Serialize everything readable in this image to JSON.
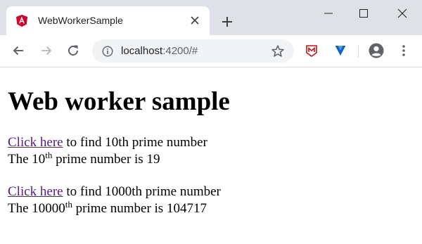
{
  "browser": {
    "tab_title": "WebWorkerSample",
    "url_host": "localhost",
    "url_path": ":4200/#",
    "icons": {
      "favicon": "angular-icon",
      "tab_close": "close-icon",
      "new_tab": "plus-icon",
      "back": "arrow-left-icon",
      "forward": "arrow-right-icon",
      "reload": "reload-icon",
      "site_info": "info-icon",
      "bookmark": "star-icon",
      "extension_1": "mcafee-icon",
      "extension_2": "vpn-icon",
      "profile": "account-icon",
      "menu": "kebab-menu-icon"
    },
    "colors": {
      "tab_strip": "#dee1e6",
      "omnibox": "#f1f3f4",
      "visited_link": "#551a8b",
      "angular_red": "#dd0031",
      "mcafee_red": "#c01818",
      "vpn_blue": "#1565c0"
    }
  },
  "page": {
    "heading": "Web worker sample",
    "link_label": "Click here",
    "row1": {
      "link_suffix": " to find 10th prime number",
      "result_prefix": "The 10",
      "result_sup": "th",
      "result_suffix": " prime number is 19"
    },
    "row2": {
      "link_suffix": " to find 1000th prime number",
      "result_prefix": "The 10000",
      "result_sup": "th",
      "result_suffix": " prime number is 104717"
    }
  }
}
